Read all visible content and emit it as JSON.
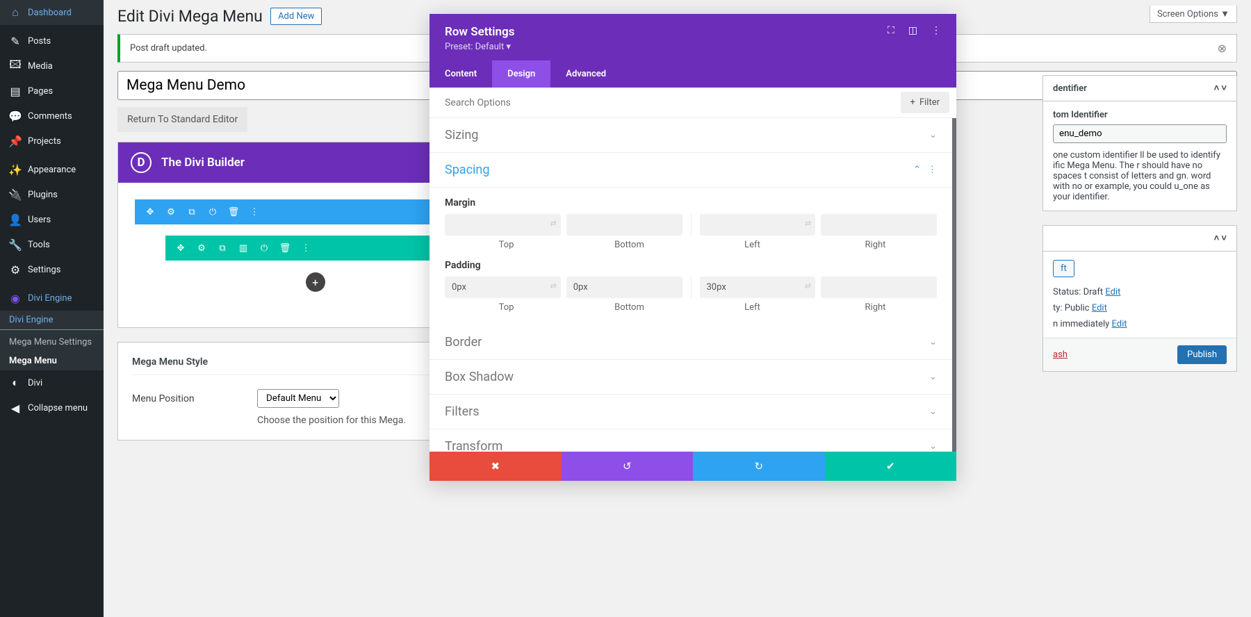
{
  "page": {
    "screen_options": "Screen Options ▼",
    "title": "Edit Divi Mega Menu",
    "add_new": "Add New",
    "notice": "Post draft updated.",
    "post_title": "Mega Menu Demo",
    "return_btn": "Return To Standard Editor"
  },
  "sidebar": {
    "items": [
      {
        "icon": "⌂",
        "label": "Dashboard"
      },
      {
        "icon": "✎",
        "label": "Posts"
      },
      {
        "icon": "🖾",
        "label": "Media"
      },
      {
        "icon": "▤",
        "label": "Pages"
      },
      {
        "icon": "💬",
        "label": "Comments"
      },
      {
        "icon": "📌",
        "label": "Projects"
      },
      {
        "icon": "✨",
        "label": "Appearance"
      },
      {
        "icon": "🔌",
        "label": "Plugins"
      },
      {
        "icon": "👤",
        "label": "Users"
      },
      {
        "icon": "🔧",
        "label": "Tools"
      },
      {
        "icon": "⚙",
        "label": "Settings"
      },
      {
        "icon": "◉",
        "label": "Divi Engine"
      }
    ],
    "submenu_title": "Divi Engine",
    "submenu": [
      "Mega Menu Settings",
      "Mega Menu"
    ],
    "divi": "Divi",
    "collapse": "Collapse menu"
  },
  "builder": {
    "title": "The Divi Builder",
    "logo": "D"
  },
  "styles": {
    "heading": "Mega Menu Style",
    "position_label": "Menu Position",
    "position_value": "Default Menu",
    "position_help": "Choose the position for this Mega."
  },
  "right": {
    "identifier_heading": "dentifier",
    "identifier_label": "tom Identifier",
    "identifier_value": "enu_demo",
    "identifier_help": "one custom identifier ll be used to identify ific Mega Menu. The r should have no spaces t consist of letters and gn. word with no or example, you could u_one as your identifier.",
    "status_label": "Status:",
    "status_value": "Draft",
    "visibility_label": "ty:",
    "visibility_value": "Public",
    "schedule": "n immediately",
    "edit": "Edit",
    "savedraft": "ft",
    "trash": "ash",
    "publish": "Publish"
  },
  "modal": {
    "title": "Row Settings",
    "preset": "Preset: Default ▾",
    "tabs": [
      "Content",
      "Design",
      "Advanced"
    ],
    "search_placeholder": "Search Options",
    "filter": "Filter",
    "groups": {
      "sizing": "Sizing",
      "spacing": "Spacing",
      "border": "Border",
      "boxshadow": "Box Shadow",
      "filters": "Filters",
      "transform": "Transform"
    },
    "spacing": {
      "margin_label": "Margin",
      "padding_label": "Padding",
      "padding_values": [
        "0px",
        "0px",
        "30px",
        ""
      ],
      "sides": [
        "Top",
        "Bottom",
        "Left",
        "Right"
      ]
    }
  }
}
